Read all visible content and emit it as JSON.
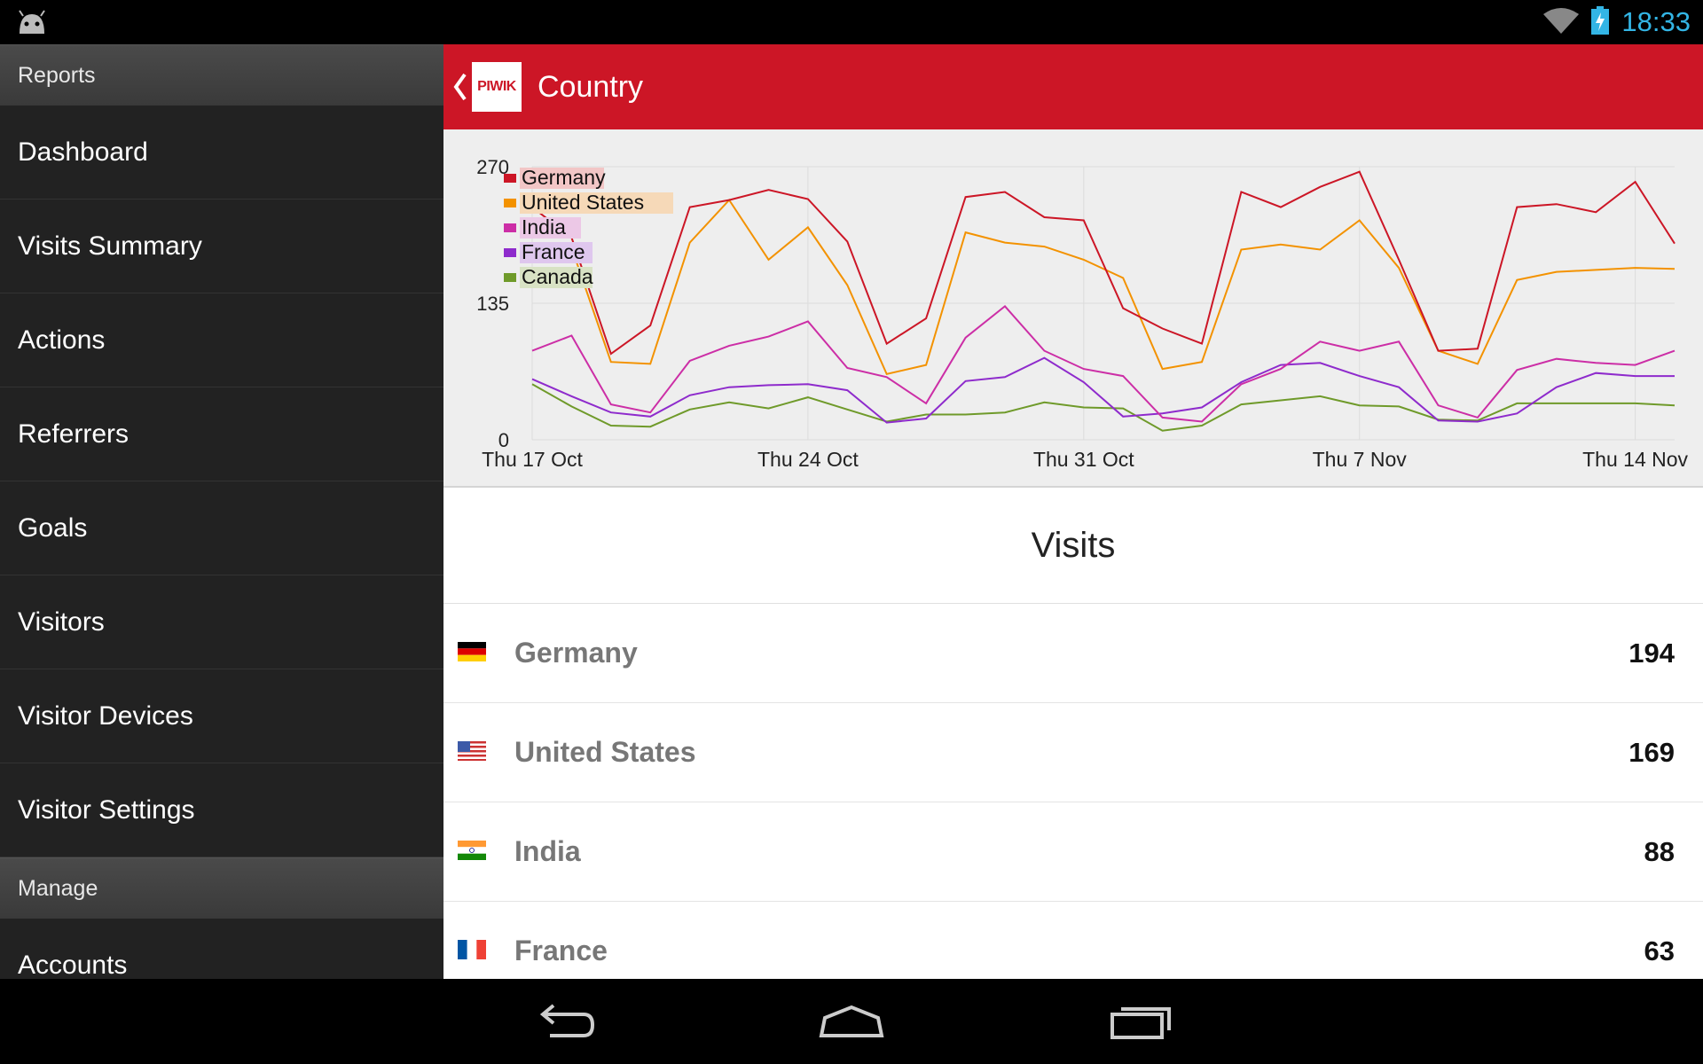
{
  "status_bar": {
    "time": "18:33",
    "icons": [
      "android-icon",
      "wifi-icon",
      "battery-charging-icon"
    ]
  },
  "sidebar": {
    "sections": [
      {
        "header": "Reports",
        "items": [
          "Dashboard",
          "Visits Summary",
          "Actions",
          "Referrers",
          "Goals",
          "Visitors",
          "Visitor Devices",
          "Visitor Settings"
        ]
      },
      {
        "header": "Manage",
        "items": [
          "Accounts"
        ]
      }
    ]
  },
  "header": {
    "logo_text": "PIWIK",
    "title": "Country",
    "accent": "#cc1626"
  },
  "chart_data": {
    "type": "line",
    "title": "",
    "xlabel": "",
    "ylabel": "",
    "ylim": [
      0,
      270
    ],
    "yticks": [
      "270",
      "135",
      "0"
    ],
    "xticks": [
      "Thu 17 Oct",
      "Thu 24 Oct",
      "Thu 31 Oct",
      "Thu 7 Nov",
      "Thu 14 Nov"
    ],
    "grid": true,
    "legend_position": "top-left",
    "x": [
      "2013-10-17",
      "2013-10-18",
      "2013-10-19",
      "2013-10-20",
      "2013-10-21",
      "2013-10-22",
      "2013-10-23",
      "2013-10-24",
      "2013-10-25",
      "2013-10-26",
      "2013-10-27",
      "2013-10-28",
      "2013-10-29",
      "2013-10-30",
      "2013-10-31",
      "2013-11-01",
      "2013-11-02",
      "2013-11-03",
      "2013-11-04",
      "2013-11-05",
      "2013-11-06",
      "2013-11-07",
      "2013-11-08",
      "2013-11-09",
      "2013-11-10",
      "2013-11-11",
      "2013-11-12",
      "2013-11-13",
      "2013-11-14",
      "2013-11-15"
    ],
    "series": [
      {
        "name": "Germany",
        "color": "#cc1626",
        "values": [
          230,
          200,
          85,
          113,
          230,
          237,
          247,
          238,
          196,
          95,
          120,
          240,
          245,
          220,
          217,
          130,
          110,
          95,
          245,
          230,
          250,
          265,
          178,
          88,
          90,
          230,
          233,
          225,
          255,
          194
        ]
      },
      {
        "name": "United States",
        "color": "#f39200",
        "values": [
          190,
          190,
          77,
          75,
          195,
          237,
          178,
          210,
          153,
          65,
          74,
          205,
          195,
          191,
          178,
          160,
          70,
          77,
          188,
          193,
          188,
          217,
          170,
          88,
          75,
          158,
          166,
          168,
          170,
          169
        ]
      },
      {
        "name": "India",
        "color": "#cc2ea6",
        "values": [
          88,
          103,
          35,
          27,
          78,
          93,
          102,
          117,
          71,
          62,
          36,
          101,
          132,
          88,
          70,
          63,
          22,
          18,
          55,
          70,
          97,
          88,
          97,
          34,
          22,
          69,
          80,
          76,
          74,
          88
        ]
      },
      {
        "name": "France",
        "color": "#8e2bcc",
        "values": [
          60,
          43,
          27,
          23,
          44,
          52,
          54,
          55,
          49,
          17,
          21,
          58,
          62,
          81,
          57,
          23,
          26,
          32,
          57,
          74,
          76,
          63,
          52,
          19,
          18,
          26,
          52,
          66,
          63,
          63
        ]
      },
      {
        "name": "Canada",
        "color": "#6f9a2a",
        "values": [
          55,
          33,
          14,
          13,
          30,
          37,
          31,
          42,
          30,
          18,
          25,
          25,
          27,
          37,
          32,
          31,
          9,
          14,
          35,
          39,
          43,
          34,
          33,
          20,
          19,
          36,
          36,
          36,
          36,
          34
        ]
      }
    ]
  },
  "table": {
    "heading": "Visits",
    "rows": [
      {
        "country": "Germany",
        "visits": "194",
        "flag": "flag-germany-icon"
      },
      {
        "country": "United States",
        "visits": "169",
        "flag": "flag-usa-icon"
      },
      {
        "country": "India",
        "visits": "88",
        "flag": "flag-india-icon"
      },
      {
        "country": "France",
        "visits": "63",
        "flag": "flag-france-icon"
      }
    ]
  },
  "nav_bar": {
    "buttons": [
      "back-icon",
      "home-icon",
      "recents-icon"
    ]
  }
}
